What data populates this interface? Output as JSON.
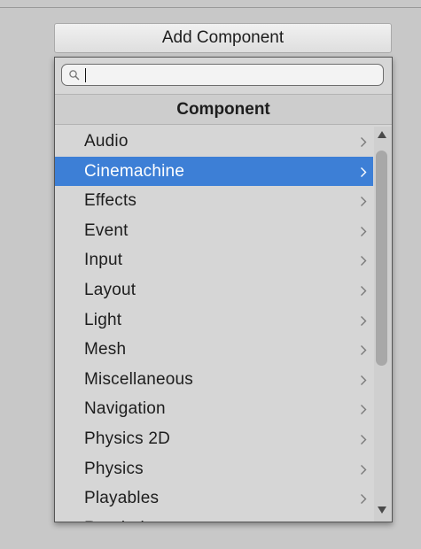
{
  "button": {
    "label": "Add Component"
  },
  "search": {
    "value": "",
    "placeholder": ""
  },
  "header": {
    "title": "Component"
  },
  "items": [
    {
      "label": "Audio"
    },
    {
      "label": "Cinemachine",
      "selected": true
    },
    {
      "label": "Effects"
    },
    {
      "label": "Event"
    },
    {
      "label": "Input"
    },
    {
      "label": "Layout"
    },
    {
      "label": "Light"
    },
    {
      "label": "Mesh"
    },
    {
      "label": "Miscellaneous"
    },
    {
      "label": "Navigation"
    },
    {
      "label": "Physics 2D"
    },
    {
      "label": "Physics"
    },
    {
      "label": "Playables"
    },
    {
      "label": "Rendering"
    }
  ],
  "icons": {
    "search": "search-icon",
    "chevron": "chevron-right-icon",
    "scroll_up": "triangle-up-icon",
    "scroll_down": "triangle-down-icon"
  },
  "colors": {
    "selection": "#3d7fd6",
    "panel": "#d6d6d6",
    "background": "#c8c8c8"
  }
}
